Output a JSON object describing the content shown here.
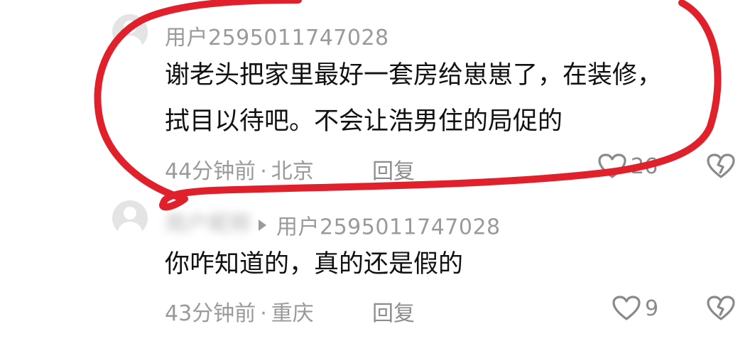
{
  "colors": {
    "annotation_circle": "#e0202a",
    "meta_gray": "#9a9a9a",
    "body_text": "#111111"
  },
  "comments": [
    {
      "username": "用户2595011747028",
      "text_line1": "谢老头把家里最好一套房给崽崽了，在装修，",
      "text_line2": "拭目以待吧。不会让浩男住的局促的",
      "time": "44分钟前",
      "location": "北京",
      "reply_label": "回复",
      "like_count": "26",
      "avatar_icon": "default-avatar-icon",
      "like_icon": "heart-outline-icon",
      "dislike_icon": "broken-heart-icon"
    },
    {
      "username": "用户昵称",
      "reply_to": "用户2595011747028",
      "text_line1": "你咋知道的，真的还是假的",
      "time": "43分钟前",
      "location": "重庆",
      "reply_label": "回复",
      "like_count": "9",
      "avatar_icon": "default-avatar-icon",
      "like_icon": "heart-outline-icon",
      "dislike_icon": "broken-heart-icon"
    }
  ],
  "separator": "·"
}
